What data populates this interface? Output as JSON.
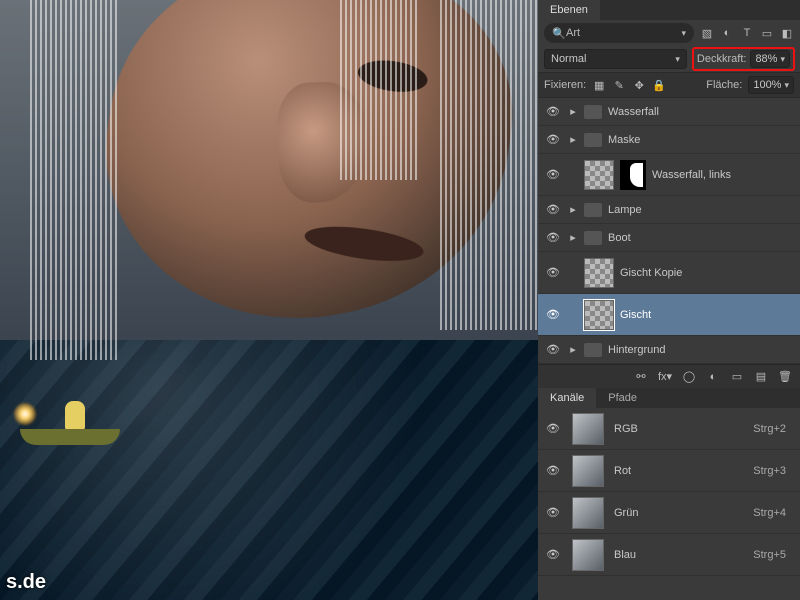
{
  "panel_tabs": {
    "layers": "Ebenen"
  },
  "search_label": "Art",
  "blend_mode": "Normal",
  "opacity": {
    "label": "Deckkraft:",
    "value": "88%"
  },
  "lock": {
    "label": "Fixieren:"
  },
  "fill": {
    "label": "Fläche:",
    "value": "100%"
  },
  "layers": [
    {
      "name": "Wasserfall",
      "type": "group"
    },
    {
      "name": "Maske",
      "type": "group"
    },
    {
      "name": "Wasserfall, links",
      "type": "layer_mask"
    },
    {
      "name": "Lampe",
      "type": "group"
    },
    {
      "name": "Boot",
      "type": "group"
    },
    {
      "name": "Gischt Kopie",
      "type": "layer"
    },
    {
      "name": "Gischt",
      "type": "layer",
      "selected": true
    },
    {
      "name": "Hintergrund",
      "type": "group"
    }
  ],
  "channel_tabs": {
    "channels": "Kanäle",
    "paths": "Pfade"
  },
  "channels": [
    {
      "name": "RGB",
      "shortcut": "Strg+2",
      "visible": true
    },
    {
      "name": "Rot",
      "shortcut": "Strg+3",
      "visible": true
    },
    {
      "name": "Grün",
      "shortcut": "Strg+4",
      "visible": true
    },
    {
      "name": "Blau",
      "shortcut": "Strg+5",
      "visible": true
    }
  ],
  "watermark": "s.de"
}
